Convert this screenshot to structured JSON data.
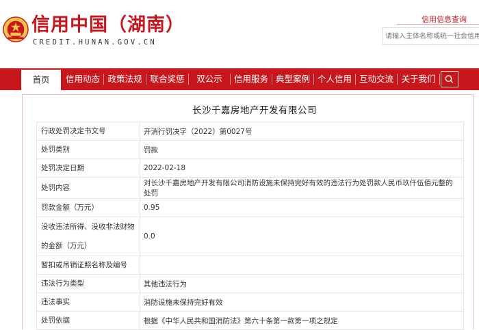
{
  "header": {
    "site_title": "信用中国（湖南）",
    "site_url": "CREDIT.HUNAN.GOV.CN",
    "credit_query_link": "信用信息查询",
    "search_placeholder": "请输入主体名称或统一社会信用代码",
    "colors": {
      "brand_red": "#c8161d",
      "emblem_gold": "#f2c44b"
    }
  },
  "nav": {
    "items": [
      {
        "label": "首页",
        "active": true
      },
      {
        "label": "信用动态"
      },
      {
        "label": "政策法规"
      },
      {
        "label": "联合奖惩"
      },
      {
        "label": "双公示"
      },
      {
        "label": "信用服务"
      },
      {
        "label": "典型案例"
      },
      {
        "label": "个人信用"
      },
      {
        "label": "互动交流"
      },
      {
        "label": "关于我们"
      }
    ],
    "search_icon": "search-icon"
  },
  "record": {
    "company_name": "长沙千嘉房地产开发有限公司",
    "rows": [
      {
        "key": "行政处罚决定书文号",
        "value": "开消行罚决字（2022）第0027号"
      },
      {
        "key": "处罚类别",
        "value": "罚款"
      },
      {
        "key": "处罚决定日期",
        "value": "2022-02-18"
      },
      {
        "key": "处罚内容",
        "value": "对长沙千嘉房地产开发有限公司消防设施未保持完好有效的违法行为处罚款人民币玖仟伍佰元整的处罚"
      },
      {
        "key": "罚款金额（万元）",
        "value": "0.95"
      },
      {
        "key": "没收违法所得、没收非法财物的金额（万元）",
        "value": "0.0"
      },
      {
        "key": "暂扣或吊销证照名称及编号",
        "value": ""
      },
      {
        "key": "违法行为类型",
        "value": "其他违法行为"
      },
      {
        "key": "违法事实",
        "value": "消防设施未保持完好有效"
      },
      {
        "key": "处罚依据",
        "value": "根据《中华人民共和国消防法》第六十条第一款第一项之规定"
      }
    ]
  }
}
